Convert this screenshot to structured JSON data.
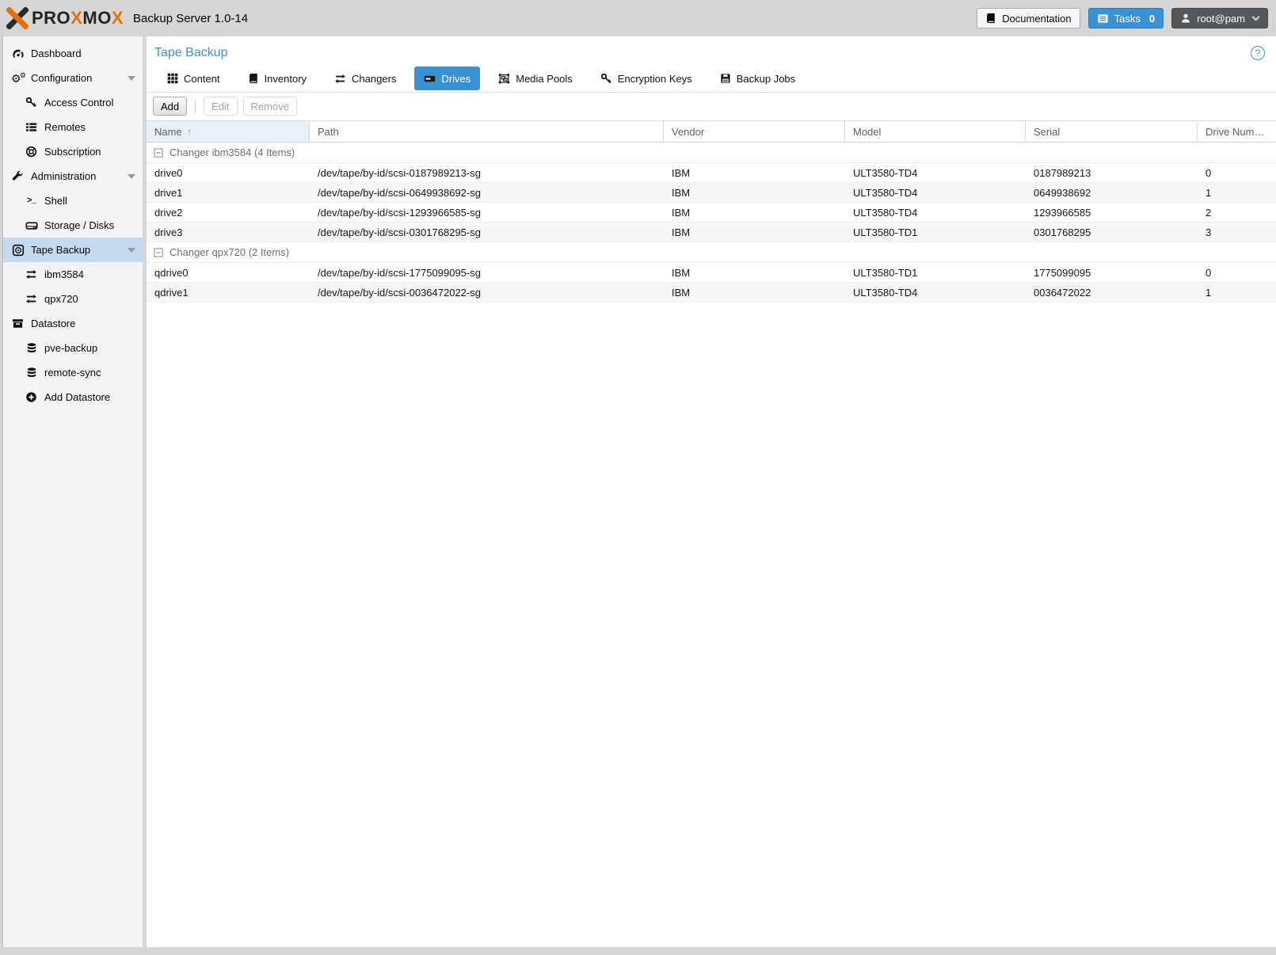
{
  "header": {
    "logo_p1": "PRO",
    "logo_x1": "X",
    "logo_p2": "MO",
    "logo_x2": "X",
    "app_title": "Backup Server 1.0-14",
    "documentation_label": "Documentation",
    "tasks_label": "Tasks",
    "tasks_count": "0",
    "user_label": "root@pam"
  },
  "sidebar": {
    "items": [
      {
        "label": "Dashboard",
        "icon": "gauge-icon",
        "level": 0
      },
      {
        "label": "Configuration",
        "icon": "gears-icon",
        "level": 0,
        "expandable": true
      },
      {
        "label": "Access Control",
        "icon": "key-icon",
        "level": 1
      },
      {
        "label": "Remotes",
        "icon": "list-icon",
        "level": 1
      },
      {
        "label": "Subscription",
        "icon": "lifering-icon",
        "level": 1
      },
      {
        "label": "Administration",
        "icon": "wrench-icon",
        "level": 0,
        "expandable": true
      },
      {
        "label": "Shell",
        "icon": "terminal-icon",
        "level": 1
      },
      {
        "label": "Storage / Disks",
        "icon": "hdd-icon",
        "level": 1
      },
      {
        "label": "Tape Backup",
        "icon": "tape-icon",
        "level": 0,
        "expandable": true,
        "selected": true
      },
      {
        "label": "ibm3584",
        "icon": "exchange-icon",
        "level": 1
      },
      {
        "label": "qpx720",
        "icon": "exchange-icon",
        "level": 1
      },
      {
        "label": "Datastore",
        "icon": "archive-icon",
        "level": 0
      },
      {
        "label": "pve-backup",
        "icon": "database-icon",
        "level": 1
      },
      {
        "label": "remote-sync",
        "icon": "database-icon",
        "level": 1
      },
      {
        "label": "Add Datastore",
        "icon": "plus-circle-icon",
        "level": 1
      }
    ]
  },
  "main": {
    "page_title": "Tape Backup",
    "tabs": [
      {
        "label": "Content",
        "icon": "grid-icon"
      },
      {
        "label": "Inventory",
        "icon": "book-icon"
      },
      {
        "label": "Changers",
        "icon": "exchange-icon"
      },
      {
        "label": "Drives",
        "icon": "tape-drive-icon",
        "active": true
      },
      {
        "label": "Media Pools",
        "icon": "object-group-icon"
      },
      {
        "label": "Encryption Keys",
        "icon": "key-icon"
      },
      {
        "label": "Backup Jobs",
        "icon": "save-icon"
      }
    ],
    "toolbar": {
      "add_label": "Add",
      "edit_label": "Edit",
      "remove_label": "Remove"
    },
    "table": {
      "columns": [
        "Name",
        "Path",
        "Vendor",
        "Model",
        "Serial",
        "Drive Num…"
      ],
      "sorted_column": "Name",
      "sort_indicator": "↑",
      "groups": [
        {
          "label": "Changer ibm3584 (4 Items)",
          "rows": [
            [
              "drive0",
              "/dev/tape/by-id/scsi-0187989213-sg",
              "IBM",
              "ULT3580-TD4",
              "0187989213",
              "0"
            ],
            [
              "drive1",
              "/dev/tape/by-id/scsi-0649938692-sg",
              "IBM",
              "ULT3580-TD4",
              "0649938692",
              "1"
            ],
            [
              "drive2",
              "/dev/tape/by-id/scsi-1293966585-sg",
              "IBM",
              "ULT3580-TD4",
              "1293966585",
              "2"
            ],
            [
              "drive3",
              "/dev/tape/by-id/scsi-0301768295-sg",
              "IBM",
              "ULT3580-TD1",
              "0301768295",
              "3"
            ]
          ]
        },
        {
          "label": "Changer qpx720 (2 Items)",
          "rows": [
            [
              "qdrive0",
              "/dev/tape/by-id/scsi-1775099095-sg",
              "IBM",
              "ULT3580-TD1",
              "1775099095",
              "0"
            ],
            [
              "qdrive1",
              "/dev/tape/by-id/scsi-0036472022-sg",
              "IBM",
              "ULT3580-TD4",
              "0036472022",
              "1"
            ]
          ]
        }
      ]
    }
  },
  "colors": {
    "accent_blue": "#3892d4",
    "brand_orange": "#e57000",
    "selected_nav": "#c3daf0",
    "sidebar_bg": "#f4f4f4",
    "frame_gray": "#d6d6d6"
  }
}
